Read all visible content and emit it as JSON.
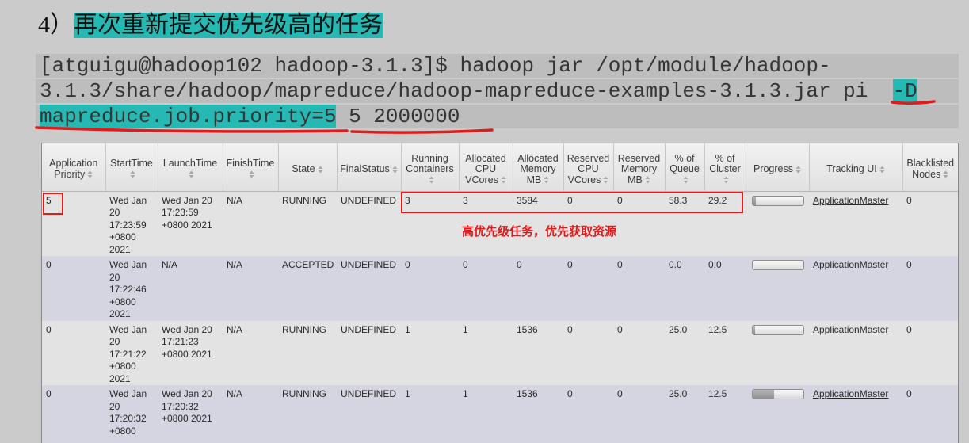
{
  "heading": {
    "number": "4）",
    "text": "再次重新提交优先级高的任务"
  },
  "code": {
    "line1": "[atguigu@hadoop102 hadoop-3.1.3]$ hadoop jar /opt/module/hadoop-",
    "line2_plain": "3.1.3/share/hadoop/mapreduce/hadoop-mapreduce-examples-3.1.3.jar pi  ",
    "line2_highlight": "-D",
    "line3_highlight": "mapreduce.job.priority=5",
    "line3_plain": " 5 2000000"
  },
  "colors": {
    "highlight": "#26b9b4",
    "annotation_red": "#e01b1b"
  },
  "yarn_table": {
    "sort_icon": "sort-icon",
    "columns": [
      "Application Priority",
      "StartTime",
      "LaunchTime",
      "FinishTime",
      "State",
      "FinalStatus",
      "Running Containers",
      "Allocated CPU VCores",
      "Allocated Memory MB",
      "Reserved CPU VCores",
      "Reserved Memory MB",
      "% of Queue",
      "% of Cluster",
      "Progress",
      "Tracking UI",
      "Blacklisted Nodes"
    ],
    "rows": [
      {
        "priority": "5",
        "start_time": "Wed Jan 20 17:23:59 +0800 2021",
        "launch_time": "Wed Jan 20 17:23:59 +0800 2021",
        "finish_time": "N/A",
        "state": "RUNNING",
        "final_status": "UNDEFINED",
        "running_containers": "3",
        "allocated_cpu_vcores": "3",
        "allocated_memory_mb": "3584",
        "reserved_cpu_vcores": "0",
        "reserved_memory_mb": "0",
        "percent_of_queue": "58.3",
        "percent_of_cluster": "29.2",
        "progress": 0.06,
        "tracking_ui": "ApplicationMaster",
        "blacklisted_nodes": "0"
      },
      {
        "priority": "0",
        "start_time": "Wed Jan 20 17:22:46 +0800 2021",
        "launch_time": "N/A",
        "finish_time": "N/A",
        "state": "ACCEPTED",
        "final_status": "UNDEFINED",
        "running_containers": "0",
        "allocated_cpu_vcores": "0",
        "allocated_memory_mb": "0",
        "reserved_cpu_vcores": "0",
        "reserved_memory_mb": "0",
        "percent_of_queue": "0.0",
        "percent_of_cluster": "0.0",
        "progress": 0,
        "tracking_ui": "ApplicationMaster",
        "blacklisted_nodes": "0"
      },
      {
        "priority": "0",
        "start_time": "Wed Jan 20 17:21:22 +0800 2021",
        "launch_time": "Wed Jan 20 17:21:23 +0800 2021",
        "finish_time": "N/A",
        "state": "RUNNING",
        "final_status": "UNDEFINED",
        "running_containers": "1",
        "allocated_cpu_vcores": "1",
        "allocated_memory_mb": "1536",
        "reserved_cpu_vcores": "0",
        "reserved_memory_mb": "0",
        "percent_of_queue": "25.0",
        "percent_of_cluster": "12.5",
        "progress": 0.04,
        "tracking_ui": "ApplicationMaster",
        "blacklisted_nodes": "0"
      },
      {
        "priority": "0",
        "start_time": "Wed Jan 20 17:20:32 +0800",
        "launch_time": "Wed Jan 20 17:20:32 +0800 2021",
        "finish_time": "N/A",
        "state": "RUNNING",
        "final_status": "UNDEFINED",
        "running_containers": "1",
        "allocated_cpu_vcores": "1",
        "allocated_memory_mb": "1536",
        "reserved_cpu_vcores": "0",
        "reserved_memory_mb": "0",
        "percent_of_queue": "25.0",
        "percent_of_cluster": "12.5",
        "progress": 0.42,
        "tracking_ui": "ApplicationMaster",
        "blacklisted_nodes": "0"
      }
    ]
  },
  "annotation": {
    "note": "高优先级任务，优先获取资源"
  }
}
